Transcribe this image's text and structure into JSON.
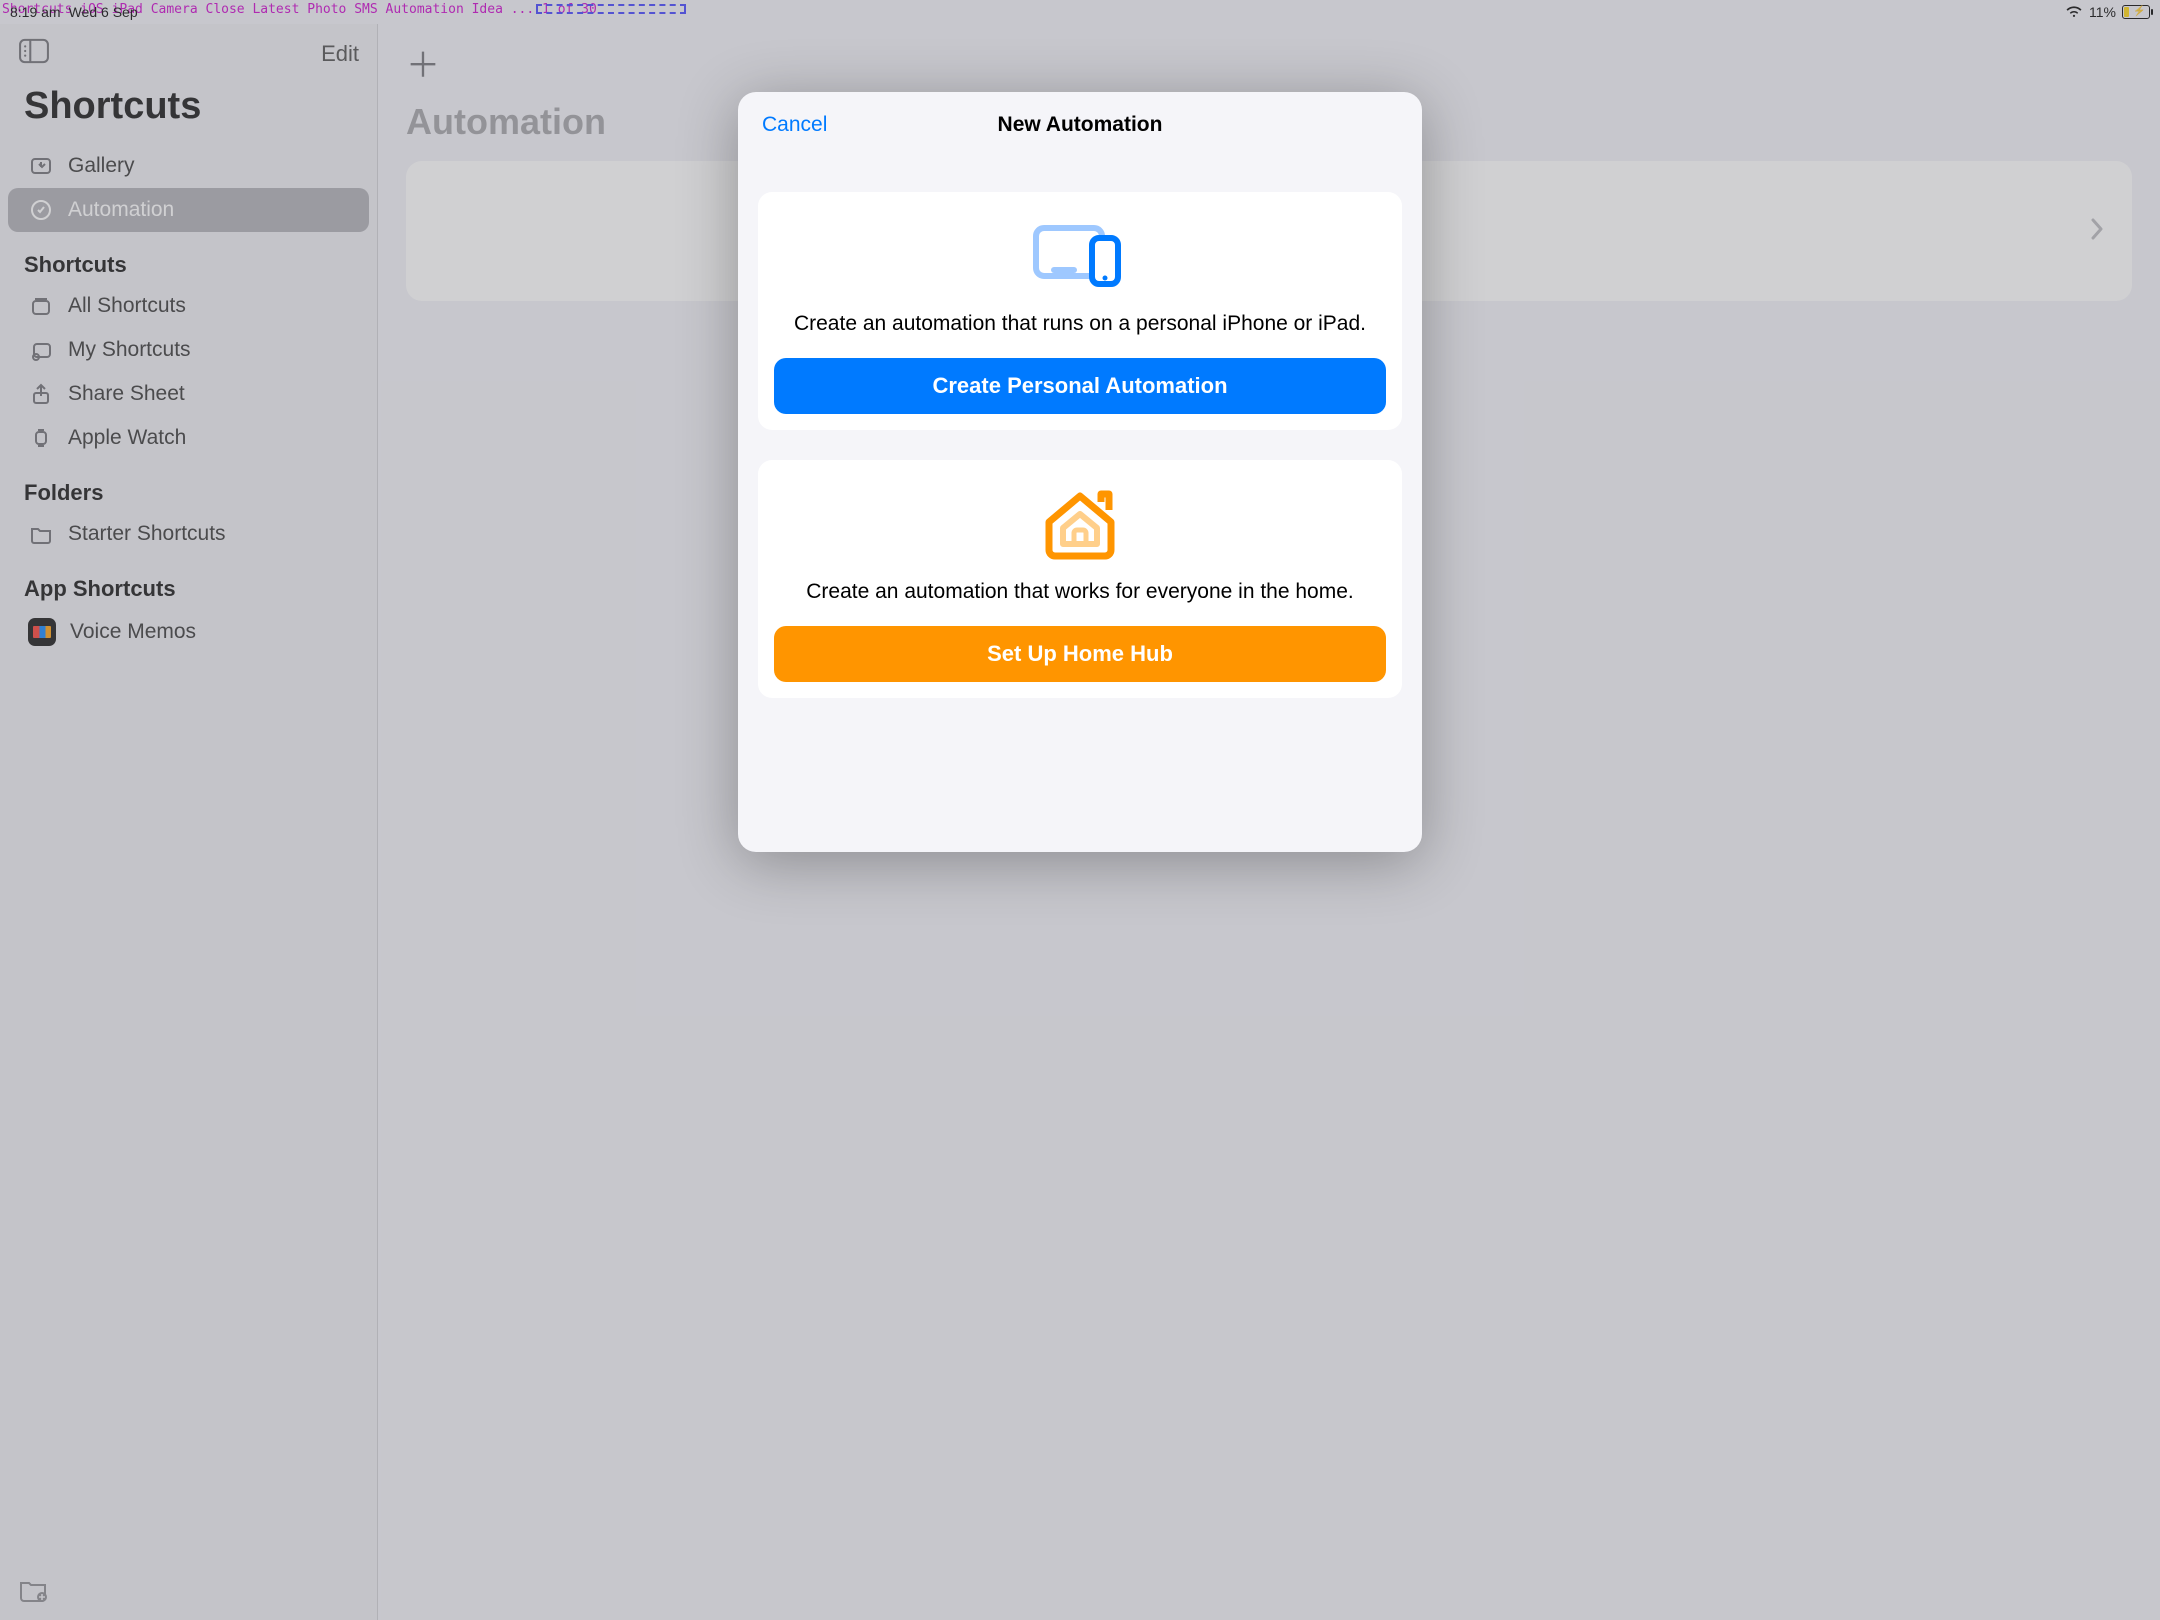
{
  "status": {
    "time": "8:19 am",
    "date": "Wed 6 Sep",
    "battery_pct": "11%",
    "overlay_text": "Shortcuts iOS iPad Camera Close Latest Photo SMS Automation Idea ... 1 of 30"
  },
  "sidebar": {
    "edit_label": "Edit",
    "app_title": "Shortcuts",
    "gallery_label": "Gallery",
    "automation_label": "Automation",
    "section_shortcuts": "Shortcuts",
    "all_shortcuts": "All Shortcuts",
    "my_shortcuts": "My Shortcuts",
    "share_sheet": "Share Sheet",
    "apple_watch": "Apple Watch",
    "section_folders": "Folders",
    "starter_shortcuts": "Starter Shortcuts",
    "section_app_shortcuts": "App Shortcuts",
    "voice_memos": "Voice Memos"
  },
  "content": {
    "title": "Automation"
  },
  "modal": {
    "cancel": "Cancel",
    "title": "New Automation",
    "personal_desc": "Create an automation that runs on a personal iPhone or iPad.",
    "personal_btn": "Create Personal Automation",
    "home_desc": "Create an automation that works for everyone in the home.",
    "home_btn": "Set Up Home Hub"
  }
}
